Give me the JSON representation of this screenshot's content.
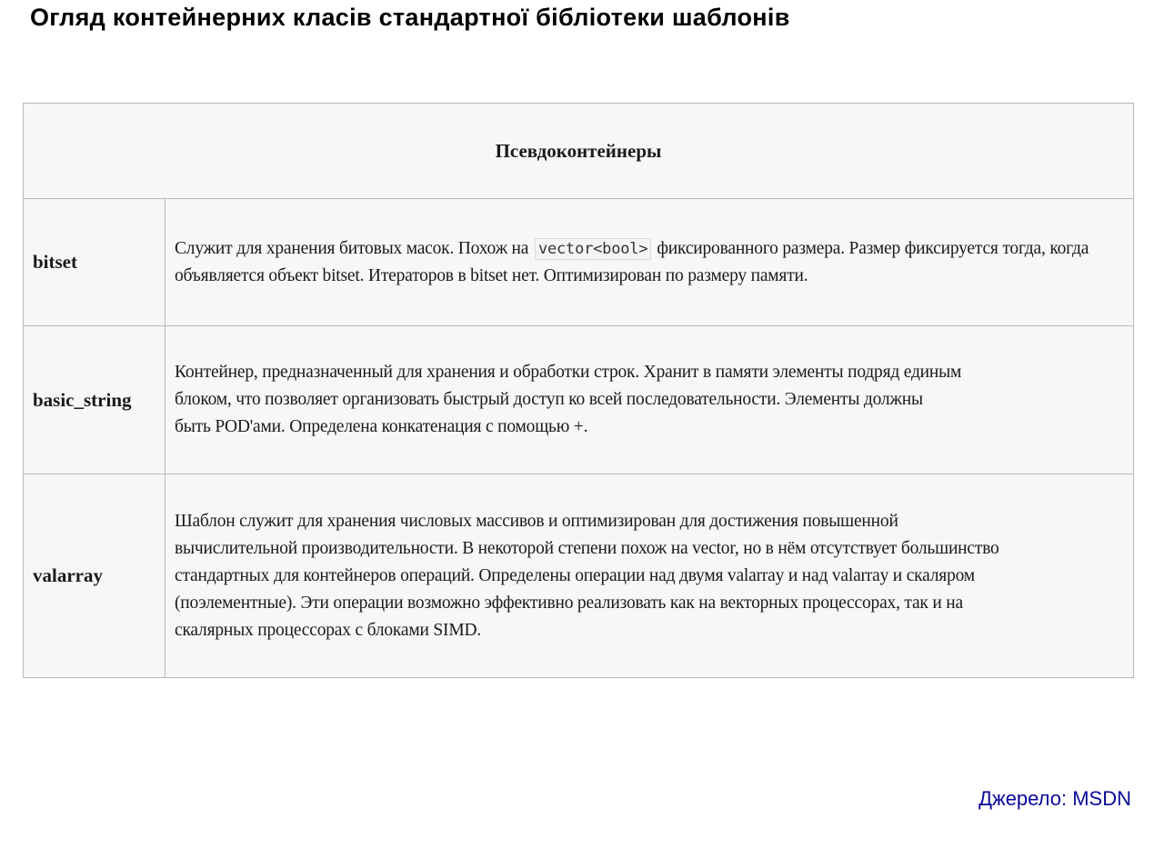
{
  "slide": {
    "title": "Огляд контейнерних класів стандартної бібліотеки шаблонів",
    "source": "Джерело: MSDN"
  },
  "table": {
    "header": "Псевдоконтейнеры",
    "rows": [
      {
        "name": "bitset",
        "text_before": "Служит для хранения битовых масок. Похож на",
        "code": "vector<bool>",
        "text_after": "фиксированного размера. Размер фиксируется тогда, когда объявляется объект bitset. Итераторов в bitset нет. Оптимизирован по размеру памяти."
      },
      {
        "name": "basic_string",
        "line1": "Контейнер, предназначенный для хранения и обработки строк. Хранит в памяти элементы подряд единым",
        "line2": "блоком, что позволяет организовать быстрый доступ ко всей последовательности. Элементы должны",
        "line3": "быть POD'ами. Определена конкатенация с помощью +."
      },
      {
        "name": "valarray",
        "line1": "Шаблон служит для хранения числовых массивов и оптимизирован для достижения повышенной",
        "line2": "вычислительной производительности. В некоторой степени похож на vector, но в нём отсутствует большинство",
        "line3": "стандартных для контейнеров операций. Определены операции над двумя valarray и над valarray и скаляром",
        "line4": "(поэлементные). Эти операции возможно эффективно реализовать как на векторных процессорах, так и на",
        "line5": "скалярных процессорах с блоками SIMD."
      }
    ]
  }
}
